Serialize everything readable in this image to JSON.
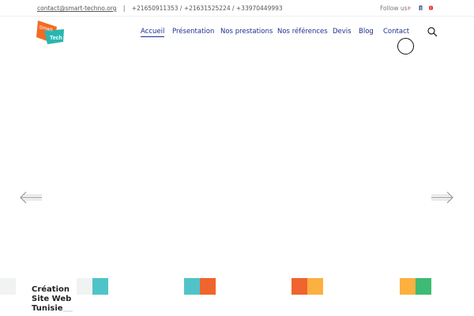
{
  "topbar": {
    "email": "contact@smart-techno.org",
    "separator": "|",
    "phones": "+21650911353 / +21631525224 / +33970449993",
    "follow_label": "Follow us:",
    "social_icons": [
      "google-plus-icon",
      "facebook-icon",
      "youtube-icon"
    ],
    "social_colors": [
      "#d9a7a0",
      "#3b5998",
      "#e53935"
    ]
  },
  "logo": {
    "line1": "Smart",
    "line2": "Tech",
    "colors": {
      "orange": "#f26a21",
      "teal": "#29b6b1"
    }
  },
  "nav": {
    "items": [
      {
        "label": "Accueil",
        "active": true
      },
      {
        "label": "Présentation",
        "active": false
      },
      {
        "label": "Nos prestations",
        "active": false
      },
      {
        "label": "Nos références",
        "active": false
      },
      {
        "label": "Devis",
        "active": false
      },
      {
        "label": "Blog",
        "active": false
      },
      {
        "label": "Contact",
        "active": false
      }
    ],
    "color": "#1e2f8e"
  },
  "slider": {
    "prev_icon": "arrow-left-icon",
    "next_icon": "arrow-right-icon"
  },
  "bottom": {
    "caption": [
      "Création",
      "Site Web",
      "Tunisie"
    ],
    "colors": {
      "teal": "#4fc4c8",
      "orange": "#f0642d",
      "yellow": "#fbb040",
      "green": "#3dbb74"
    }
  }
}
